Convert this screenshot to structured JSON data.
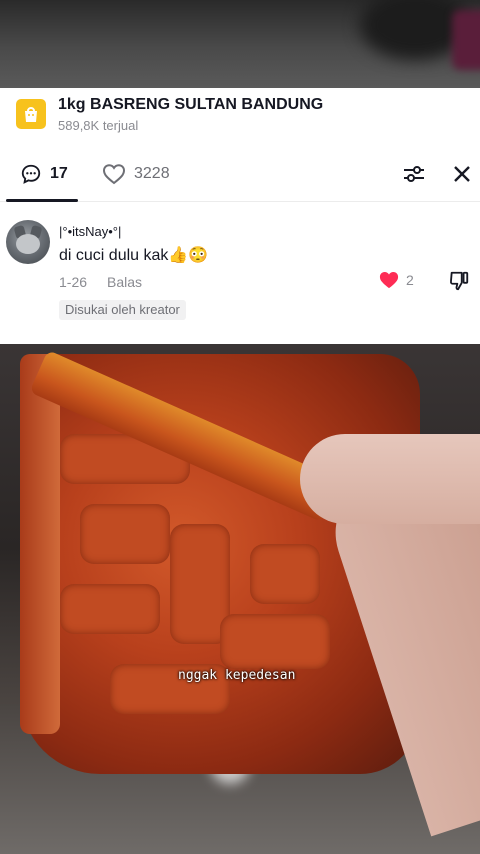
{
  "product": {
    "title": "1kg  BASRENG SULTAN BANDUNG",
    "sold": "589,8K terjual",
    "icon": "shopping-bag-icon",
    "icon_color": "#f7c21d"
  },
  "tabs": {
    "comments_count": "17",
    "likes_count": "3228"
  },
  "comment": {
    "username": "|°•itsNay•°|",
    "text": "di cuci dulu kak",
    "emojis": "👍😳",
    "date": "1-26",
    "reply_label": "Balas",
    "like_count": "2",
    "creator_badge": "Disukai oleh kreator",
    "like_color": "#fe2c55"
  },
  "video": {
    "caption": "nggak kepedesan"
  }
}
